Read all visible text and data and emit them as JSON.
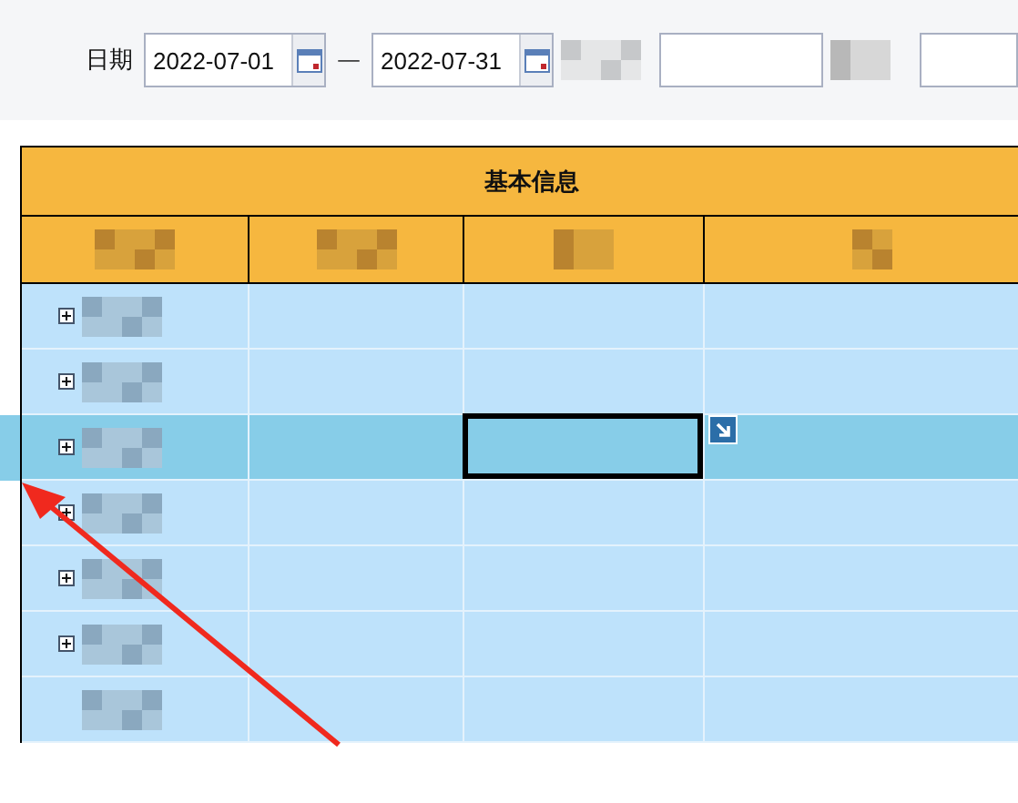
{
  "filter": {
    "date_label": "日期",
    "start_date": "2022-07-01",
    "separator": "—",
    "end_date": "2022-07-31"
  },
  "table": {
    "group_header": "基本信息",
    "rows": [
      {
        "expandable": true,
        "selected": false,
        "editing": false
      },
      {
        "expandable": true,
        "selected": false,
        "editing": false
      },
      {
        "expandable": true,
        "selected": true,
        "editing": true
      },
      {
        "expandable": true,
        "selected": false,
        "editing": false
      },
      {
        "expandable": true,
        "selected": false,
        "editing": false
      },
      {
        "expandable": true,
        "selected": false,
        "editing": false
      },
      {
        "expandable": false,
        "selected": false,
        "editing": false
      }
    ]
  }
}
